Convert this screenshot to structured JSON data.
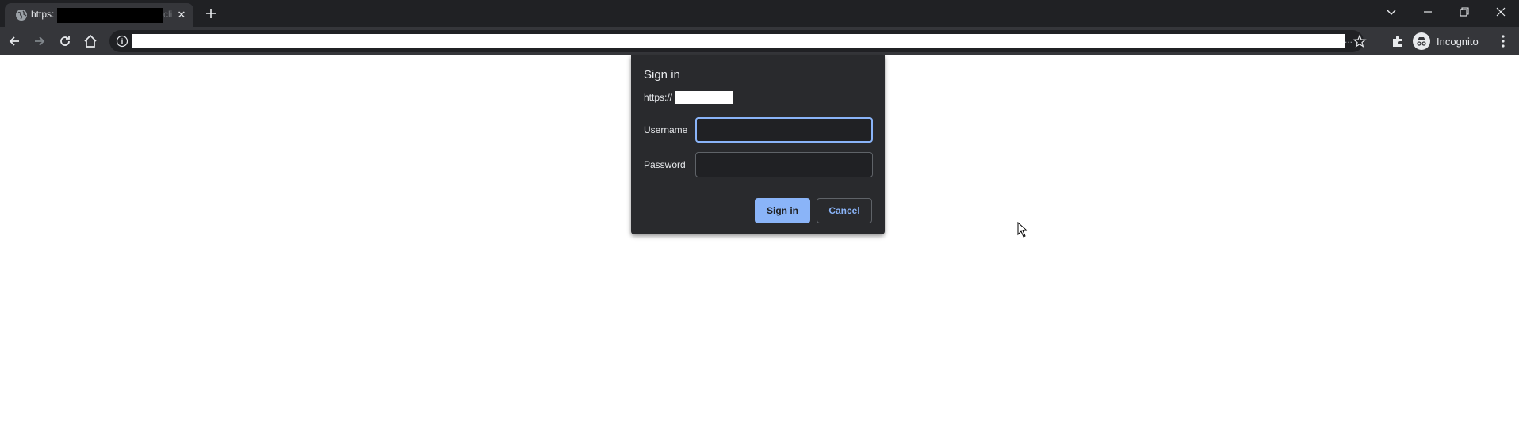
{
  "browser": {
    "tab": {
      "title_visible": "https:",
      "title_fade": "cli",
      "favicon": "globe-icon",
      "close_glyph": "✕"
    },
    "new_tab_icon": "plus-icon",
    "window_controls": [
      "tab-search-icon",
      "minimize-icon",
      "restore-icon",
      "close-icon"
    ],
    "toolbar": {
      "back_icon": "back-arrow-icon",
      "forward_icon": "forward-arrow-icon",
      "reload_icon": "reload-icon",
      "home_icon": "home-icon",
      "site_info_icon": "info-icon",
      "omnibox_ellipsis": "...",
      "bookmark_icon": "star-icon",
      "extensions_icon": "puzzle-icon",
      "profile_label": "Incognito",
      "menu_icon": "kebab-menu-icon"
    }
  },
  "dialog": {
    "title": "Sign in",
    "origin": "https://",
    "username_label": "Username",
    "username_value": "",
    "password_label": "Password",
    "password_value": "",
    "signin_button": "Sign in",
    "cancel_button": "Cancel"
  },
  "colors": {
    "tabstrip_bg": "#202124",
    "toolbar_bg": "#35363a",
    "dialog_bg": "#292a2d",
    "accent": "#8ab4f8",
    "text": "#e8eaed",
    "page_bg": "#ffffff"
  }
}
